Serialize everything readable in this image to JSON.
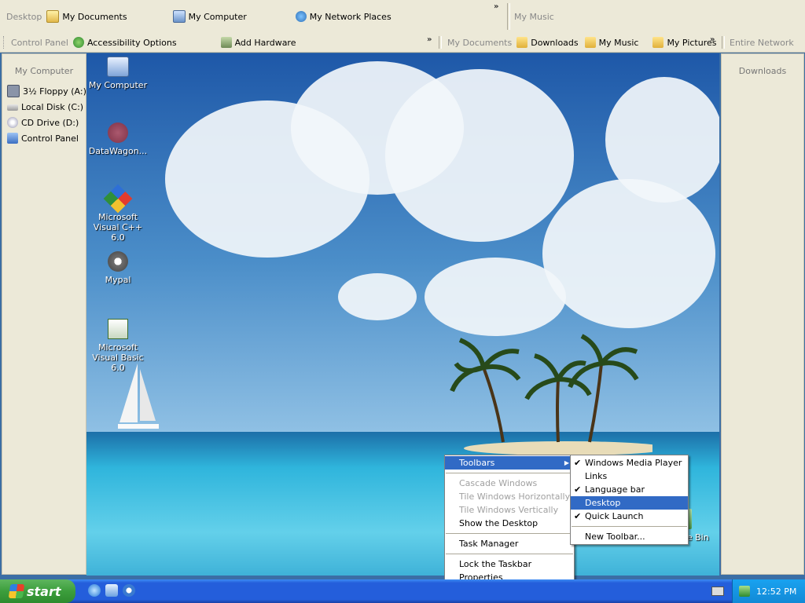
{
  "toolbar_top": {
    "desktop_title": "Desktop",
    "items": [
      {
        "label": "My Documents",
        "icon": "documents-icon"
      },
      {
        "label": "My Computer",
        "icon": "computer-icon"
      },
      {
        "label": "My Network Places",
        "icon": "network-icon"
      }
    ],
    "my_music_title": "My Music"
  },
  "toolbar_second": {
    "control_panel_title": "Control Panel",
    "cp_items": [
      {
        "label": "Accessibility Options",
        "icon": "accessibility-icon"
      },
      {
        "label": "Add Hardware",
        "icon": "hardware-icon"
      }
    ],
    "my_documents_title": "My Documents",
    "doc_items": [
      {
        "label": "Downloads",
        "icon": "folder-icon"
      },
      {
        "label": "My Music",
        "icon": "music-folder-icon"
      },
      {
        "label": "My Pictures",
        "icon": "pictures-folder-icon"
      }
    ],
    "entire_network_title": "Entire Network"
  },
  "left_panel": {
    "title": "My Computer",
    "items": [
      {
        "label": "3½ Floppy (A:)",
        "icon": "floppy-icon"
      },
      {
        "label": "Local Disk (C:)",
        "icon": "harddisk-icon"
      },
      {
        "label": "CD Drive (D:)",
        "icon": "cd-drive-icon"
      },
      {
        "label": "Control Panel",
        "icon": "control-panel-icon"
      }
    ]
  },
  "right_panel": {
    "title": "Downloads"
  },
  "desktop_icons": [
    {
      "label": "My Computer",
      "icon": "computer-icon"
    },
    {
      "label": "DataWagon...",
      "icon": "datawagon-icon"
    },
    {
      "label": "Microsoft Visual C++ 6.0",
      "icon": "visual-cpp-icon"
    },
    {
      "label": "Mypal",
      "icon": "mypal-icon"
    },
    {
      "label": "Microsoft Visual Basic 6.0",
      "icon": "visual-basic-icon"
    },
    {
      "label": "Recycle Bin",
      "icon": "recycle-bin-icon"
    }
  ],
  "context_menu": {
    "items": [
      {
        "label": "Toolbars",
        "state": "highlighted",
        "submenu": true
      },
      {
        "label": "Cascade Windows",
        "state": "disabled"
      },
      {
        "label": "Tile Windows Horizontally",
        "state": "disabled"
      },
      {
        "label": "Tile Windows Vertically",
        "state": "disabled"
      },
      {
        "label": "Show the Desktop",
        "state": "enabled"
      },
      {
        "label": "Task Manager",
        "state": "enabled"
      },
      {
        "label": "Lock the Taskbar",
        "state": "enabled"
      },
      {
        "label": "Properties",
        "state": "enabled"
      }
    ]
  },
  "toolbars_submenu": {
    "items": [
      {
        "label": "Windows Media Player",
        "checked": true
      },
      {
        "label": "Links",
        "checked": false
      },
      {
        "label": "Language bar",
        "checked": true
      },
      {
        "label": "Desktop",
        "checked": false,
        "highlighted": true
      },
      {
        "label": "Quick Launch",
        "checked": true
      },
      {
        "label": "New Toolbar...",
        "checked": false
      }
    ]
  },
  "taskbar": {
    "start_label": "start",
    "quick_launch": [
      "ie-icon",
      "outlook-icon",
      "media-player-icon"
    ],
    "clock": "12:52 PM"
  },
  "colors": {
    "taskbar_blue": "#245edb",
    "start_green": "#3c9e3c",
    "menu_highlight": "#316ac5",
    "toolbar_bg": "#ece9d8"
  }
}
